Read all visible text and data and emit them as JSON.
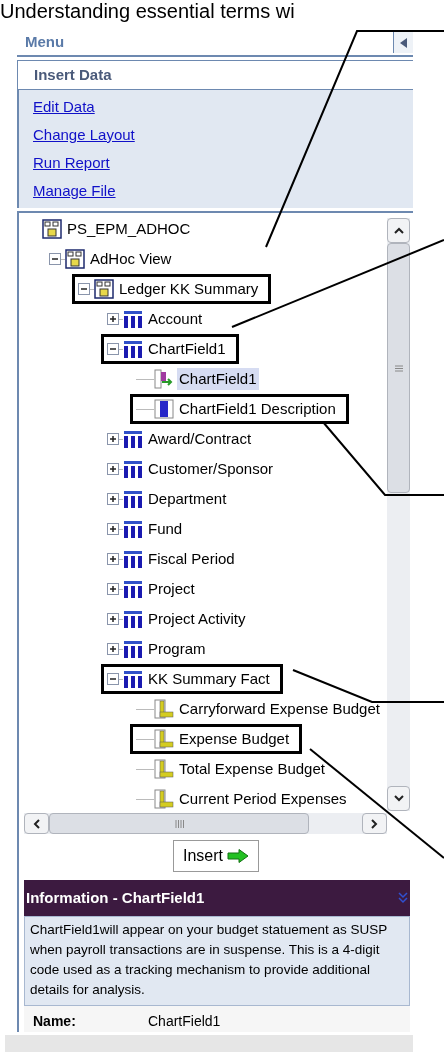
{
  "page_title": "Understanding essential terms wi",
  "menu": {
    "title": "Menu",
    "current": "Insert Data",
    "links": [
      "Edit Data",
      "Change Layout",
      "Run Report",
      "Manage File"
    ]
  },
  "tree": [
    {
      "label": "PS_EPM_ADHOC",
      "kind": "root",
      "selected": false,
      "callout": false,
      "children": [
        {
          "label": "AdHoc View",
          "kind": "view",
          "selected": false,
          "callout": false,
          "expanded": true,
          "children": [
            {
              "label": "Ledger KK Summary",
              "kind": "view",
              "selected": false,
              "callout": true,
              "expanded": true,
              "children": [
                {
                  "label": "Account",
                  "kind": "dimension",
                  "selected": false,
                  "callout": false,
                  "expanded": false
                },
                {
                  "label": "ChartField1",
                  "kind": "dimension",
                  "selected": false,
                  "callout": true,
                  "expanded": true,
                  "children": [
                    {
                      "label": "ChartField1",
                      "kind": "key",
                      "selected": true,
                      "callout": false
                    },
                    {
                      "label": "ChartField1 Description",
                      "kind": "attribute",
                      "selected": false,
                      "callout": true
                    }
                  ]
                },
                {
                  "label": "Award/Contract",
                  "kind": "dimension",
                  "selected": false,
                  "callout": false,
                  "expanded": false
                },
                {
                  "label": "Customer/Sponsor",
                  "kind": "dimension",
                  "selected": false,
                  "callout": false,
                  "expanded": false
                },
                {
                  "label": "Department",
                  "kind": "dimension",
                  "selected": false,
                  "callout": false,
                  "expanded": false
                },
                {
                  "label": "Fund",
                  "kind": "dimension",
                  "selected": false,
                  "callout": false,
                  "expanded": false
                },
                {
                  "label": "Fiscal Period",
                  "kind": "dimension",
                  "selected": false,
                  "callout": false,
                  "expanded": false
                },
                {
                  "label": "Project",
                  "kind": "dimension",
                  "selected": false,
                  "callout": false,
                  "expanded": false
                },
                {
                  "label": "Project Activity",
                  "kind": "dimension",
                  "selected": false,
                  "callout": false,
                  "expanded": false
                },
                {
                  "label": "Program",
                  "kind": "dimension",
                  "selected": false,
                  "callout": false,
                  "expanded": false
                },
                {
                  "label": "KK Summary Fact",
                  "kind": "dimension",
                  "selected": false,
                  "callout": true,
                  "expanded": true,
                  "children": [
                    {
                      "label": "Carryforward Expense Budget",
                      "kind": "measure",
                      "selected": false,
                      "callout": false
                    },
                    {
                      "label": "Expense Budget",
                      "kind": "measure",
                      "selected": false,
                      "callout": true
                    },
                    {
                      "label": "Total Expense Budget",
                      "kind": "measure",
                      "selected": false,
                      "callout": false
                    },
                    {
                      "label": "Current Period Expenses",
                      "kind": "measure",
                      "selected": false,
                      "callout": false
                    }
                  ]
                }
              ]
            }
          ]
        }
      ]
    }
  ],
  "insert_button": "Insert",
  "info": {
    "title": "Information - ChartField1",
    "body": "ChartField1will appear on your budget statuement as SUSP when payroll transactions are in suspense. This is a 4-digit code used as a tracking mechanism to provide additional details for analysis.",
    "name_label": "Name:",
    "name_value": "ChartField1"
  }
}
